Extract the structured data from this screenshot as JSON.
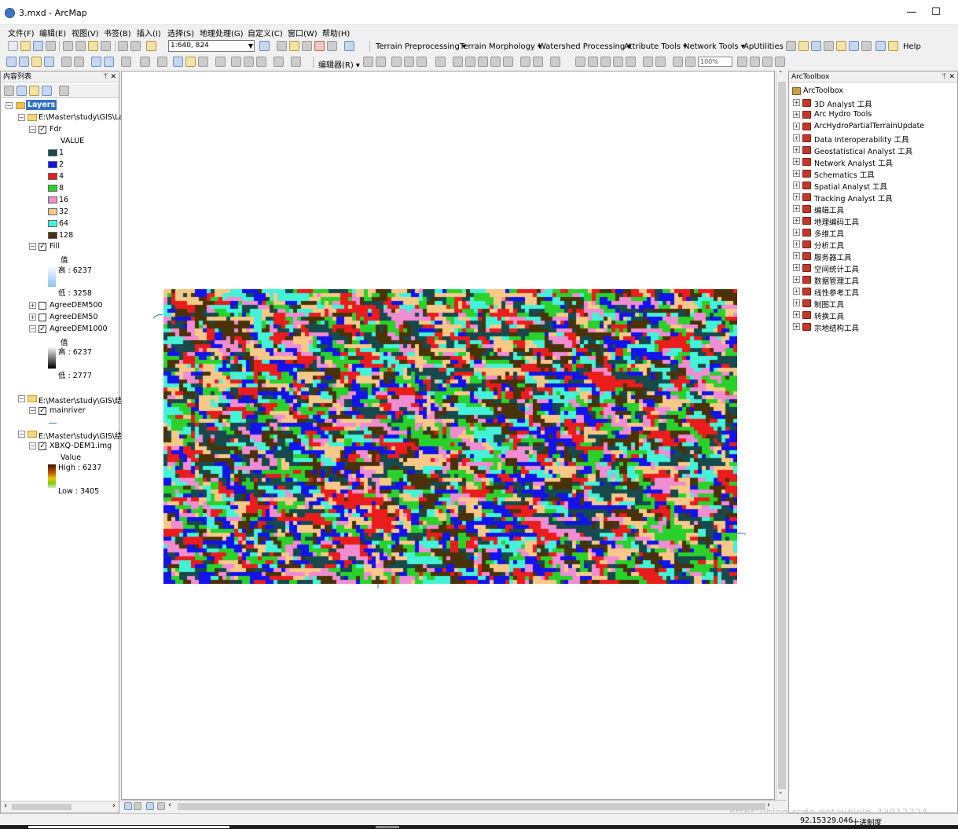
{
  "window": {
    "title": "3.mxd - ArcMap",
    "min": "—",
    "max": "☐"
  },
  "menu": [
    "文件(F)",
    "编辑(E)",
    "视图(V)",
    "书签(B)",
    "插入(I)",
    "选择(S)",
    "地理处理(G)",
    "自定义(C)",
    "窗口(W)",
    "帮助(H)"
  ],
  "toolbar": {
    "scale": "1:640, 824",
    "custom_menus": [
      "Terrain Preprocessing ▾",
      "Terrain Morphology ▾",
      "Watershed Processing ▾",
      "Attribute Tools ▾",
      "Network Tools ▾",
      "ApUtilities ▾"
    ],
    "help": "Help",
    "editor": "编辑器(R) ▾",
    "zoom": "100%"
  },
  "toc": {
    "title": "内容列表",
    "layers_root": "Layers",
    "group1": "E:\\Master\\study\\GIS\\La",
    "fdr": {
      "name": "Fdr",
      "field": "VALUE",
      "classes": [
        {
          "label": "1",
          "color": "#17494d"
        },
        {
          "label": "2",
          "color": "#1313ea"
        },
        {
          "label": "4",
          "color": "#ea1c1c"
        },
        {
          "label": "8",
          "color": "#2bd12b"
        },
        {
          "label": "16",
          "color": "#f08cd2"
        },
        {
          "label": "32",
          "color": "#f8c887"
        },
        {
          "label": "64",
          "color": "#44f2d8"
        },
        {
          "label": "128",
          "color": "#4a3208"
        }
      ]
    },
    "fill": {
      "name": "Fill",
      "field": "值",
      "high": "高 : 6237",
      "low": "低 : 3258"
    },
    "dem500": "AgreeDEM500",
    "dem50": "AgreeDEM50",
    "dem1000": {
      "name": "AgreeDEM1000",
      "field": "值",
      "high": "高 : 6237",
      "low": "低 : 2777"
    },
    "group2": "E:\\Master\\study\\GIS\\结",
    "mainriver": "mainriver",
    "group3": "E:\\Master\\study\\GIS\\结",
    "xbxq": {
      "name": "XBXQ-DEM1.img",
      "field": "Value",
      "high": "High : 6237",
      "low": "Low : 3405"
    }
  },
  "arctoolbox": {
    "title": "ArcToolbox",
    "root": "ArcToolbox",
    "items": [
      "3D Analyst 工具",
      "Arc Hydro Tools",
      "ArcHydroPartialTerrainUpdate",
      "Data Interoperability 工具",
      "Geostatistical Analyst 工具",
      "Network Analyst 工具",
      "Schematics 工具",
      "Spatial Analyst 工具",
      "Tracking Analyst 工具",
      "编辑工具",
      "地理编码工具",
      "多维工具",
      "分析工具",
      "服务器工具",
      "空间统计工具",
      "数据管理工具",
      "线性参考工具",
      "制图工具",
      "转换工具",
      "宗地结构工具"
    ]
  },
  "status": {
    "x": "92.153",
    "y": "29.046",
    "unit": "十进制度"
  },
  "watermark": "https://blog.csdn.net/weixin_43012724"
}
